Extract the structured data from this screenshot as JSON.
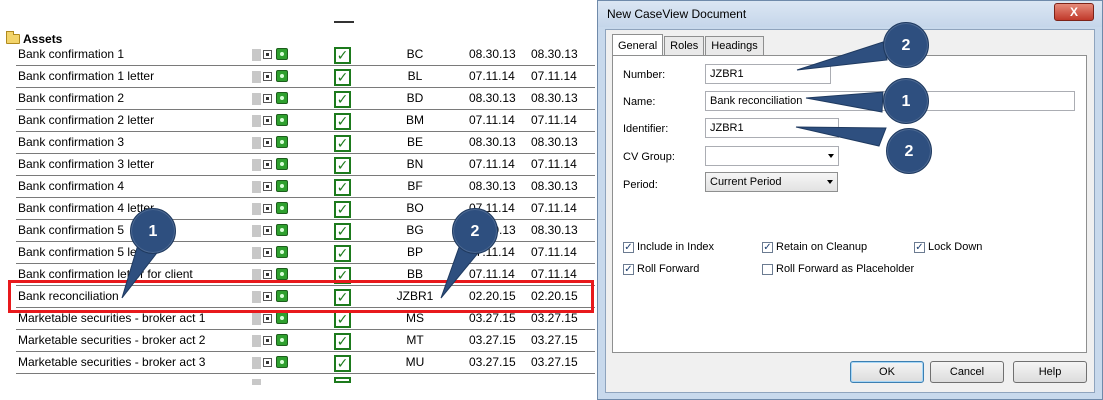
{
  "list": {
    "group_label": "Assets",
    "rows": [
      {
        "name": "Bank confirmation 1",
        "code": "BC",
        "date1": "08.30.13",
        "date2": "08.30.13"
      },
      {
        "name": "Bank confirmation 1 letter",
        "code": "BL",
        "date1": "07.11.14",
        "date2": "07.11.14"
      },
      {
        "name": "Bank confirmation 2",
        "code": "BD",
        "date1": "08.30.13",
        "date2": "08.30.13"
      },
      {
        "name": "Bank confirmation 2 letter",
        "code": "BM",
        "date1": "07.11.14",
        "date2": "07.11.14"
      },
      {
        "name": "Bank confirmation 3",
        "code": "BE",
        "date1": "08.30.13",
        "date2": "08.30.13"
      },
      {
        "name": "Bank confirmation 3 letter",
        "code": "BN",
        "date1": "07.11.14",
        "date2": "07.11.14"
      },
      {
        "name": "Bank confirmation 4",
        "code": "BF",
        "date1": "08.30.13",
        "date2": "08.30.13"
      },
      {
        "name": "Bank confirmation 4 letter",
        "code": "BO",
        "date1": "07.11.14",
        "date2": "07.11.14"
      },
      {
        "name": "Bank confirmation 5",
        "code": "BG",
        "date1": "08.30.13",
        "date2": "08.30.13"
      },
      {
        "name": "Bank confirmation 5 letter",
        "code": "BP",
        "date1": "07.11.14",
        "date2": "07.11.14"
      },
      {
        "name": "Bank confirmation letter for client",
        "code": "BB",
        "date1": "07.11.14",
        "date2": "07.11.14"
      },
      {
        "name": "Bank reconciliation",
        "code": "JZBR1",
        "date1": "02.20.15",
        "date2": "02.20.15"
      },
      {
        "name": "Marketable securities - broker act 1",
        "code": "MS",
        "date1": "03.27.15",
        "date2": "03.27.15"
      },
      {
        "name": "Marketable securities - broker act 2",
        "code": "MT",
        "date1": "03.27.15",
        "date2": "03.27.15"
      },
      {
        "name": "Marketable securities - broker act 3",
        "code": "MU",
        "date1": "03.27.15",
        "date2": "03.27.15"
      }
    ]
  },
  "callouts": {
    "left_one": "1",
    "left_two": "2",
    "dlg_number": "2",
    "dlg_name": "1",
    "dlg_identifier": "2"
  },
  "dialog": {
    "title": "New CaseView Document",
    "close_label": "X",
    "tabs": [
      "General",
      "Roles",
      "Headings"
    ],
    "labels": {
      "number": "Number:",
      "name": "Name:",
      "identifier": "Identifier:",
      "cv_group": "CV Group:",
      "period": "Period:"
    },
    "values": {
      "number": "JZBR1",
      "name": "Bank reconciliation",
      "identifier": "JZBR1",
      "cv_group": "",
      "period": "Current Period"
    },
    "checkboxes": {
      "include_in_index": {
        "label": "Include in Index",
        "checked": true
      },
      "retain_on_cleanup": {
        "label": "Retain on Cleanup",
        "checked": true
      },
      "lock_down": {
        "label": "Lock Down",
        "checked": true
      },
      "roll_forward": {
        "label": "Roll Forward",
        "checked": true
      },
      "roll_forward_placeholder": {
        "label": "Roll Forward as Placeholder",
        "checked": false
      }
    },
    "buttons": {
      "ok": "OK",
      "cancel": "Cancel",
      "help": "Help"
    }
  },
  "colors": {
    "callout": "#2e4f7f",
    "highlight": "#e8191c",
    "check_green": "#1d7a1d"
  }
}
